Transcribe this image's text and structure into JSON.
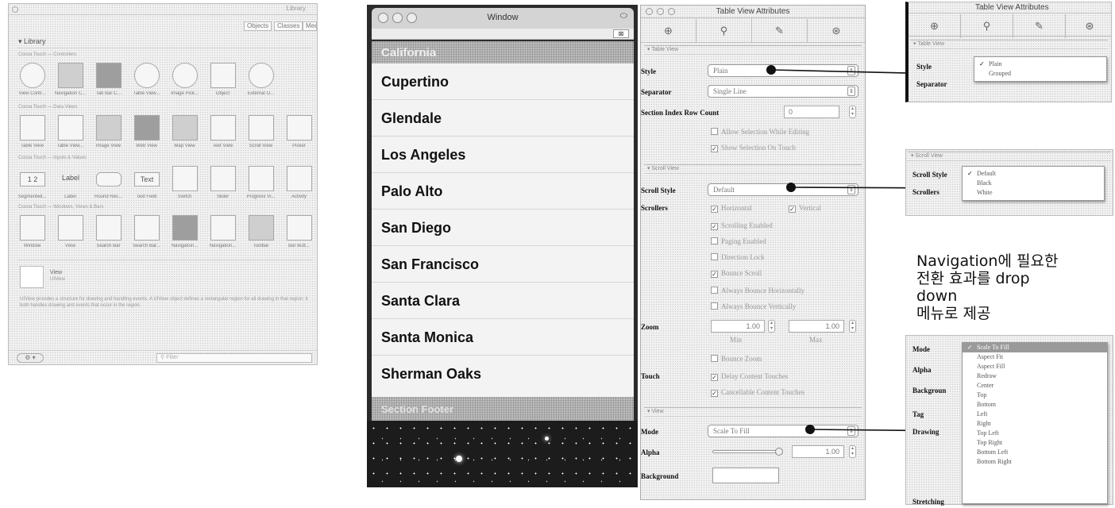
{
  "library": {
    "window_title": "Library",
    "segments": [
      "Objects",
      "Classes",
      "Media"
    ],
    "header_label": "Library",
    "sections": [
      "Cocoa Touch — Controllers",
      "Cocoa Touch — Data Views",
      "Cocoa Touch — Inputs & Values",
      "Cocoa Touch — Windows, Views & Bars"
    ],
    "tiles": [
      [
        "View Contr...",
        "Navigation C...",
        "Tab Bar C...",
        "Table View...",
        "Image Pick...",
        "Object",
        "External O..."
      ],
      [
        "Table View",
        "Table View...",
        "Image View",
        "Web View",
        "Map View",
        "Text View",
        "Scroll View",
        "Picker"
      ],
      [
        "Segmented...",
        "Label",
        "Round Rec...",
        "Text Field",
        "Switch",
        "Slider",
        "Progress Vi...",
        "Activity"
      ],
      [
        "Window",
        "View",
        "Search Bar",
        "Search Bar...",
        "Navigation...",
        "Navigation...",
        "Toolbar",
        "Bar Butt..."
      ]
    ],
    "tile_icons": [
      [
        "view-controller-icon",
        "navigation-controller-icon",
        "tab-bar-controller-icon",
        "table-view-controller-icon",
        "image-picker-icon",
        "object-icon",
        "external-object-icon"
      ],
      [
        "table-view-icon",
        "table-view-cell-icon",
        "image-view-icon",
        "web-view-icon",
        "map-view-icon",
        "text-view-icon",
        "scroll-view-icon",
        "picker-icon"
      ],
      [
        "segmented-control-icon",
        "label-icon",
        "round-rect-button-icon",
        "text-field-icon",
        "switch-icon",
        "slider-icon",
        "progress-view-icon",
        "activity-indicator-icon"
      ],
      [
        "window-icon",
        "view-icon",
        "search-bar-icon",
        "search-bar-controller-icon",
        "navigation-bar-icon",
        "navigation-item-icon",
        "toolbar-icon",
        "bar-button-item-icon"
      ]
    ],
    "label_tile_text": "Label",
    "text_tile_text": "Text",
    "segmented_tile_text": "1 2",
    "detail_name": "View",
    "detail_sub": "UIView",
    "detail_desc": "UIView provides a structure for drawing and handling events. A UIView object defines a rectangular region for all drawing in that region; it both handles drawing and events that occur in the region.",
    "gear_label": "⚙ ▾",
    "filter_placeholder": "Filter"
  },
  "simulator": {
    "window_title": "Window",
    "header": "California",
    "rows": [
      "Cupertino",
      "Glendale",
      "Los Angeles",
      "Palo Alto",
      "San Diego",
      "San Francisco",
      "Santa Clara",
      "Santa Monica",
      "Sherman Oaks"
    ],
    "footer": "Section Footer",
    "mini_btn": "⊠"
  },
  "inspector": {
    "title": "Table View Attributes",
    "tabs": [
      "⊕",
      "⚲",
      "✎",
      "⊛"
    ],
    "table_view": {
      "header": "▾ Table View",
      "style_label": "Style",
      "style_value": "Plain",
      "separator_label": "Separator",
      "separator_value": "Single Line",
      "section_index_label": "Section Index Row Count",
      "section_index_value": "0",
      "allow_selection_editing": "Allow Selection While Editing",
      "show_selection_touch": "Show Selection On Touch"
    },
    "scroll_view": {
      "header": "▾ Scroll View",
      "style_label": "Scroll Style",
      "style_value": "Default",
      "scrollers_label": "Scrollers",
      "horizontal": "Horizontal",
      "vertical": "Vertical",
      "scrolling_enabled": "Scrolling Enabled",
      "paging_enabled": "Paging Enabled",
      "direction_lock": "Direction Lock",
      "bounce_scroll": "Bounce Scroll",
      "always_bounce_h": "Always Bounce Horizontally",
      "always_bounce_v": "Always Bounce Vertically",
      "zoom_label": "Zoom",
      "zoom_min": "1.00",
      "zoom_max": "1.00",
      "min_label": "Min",
      "max_label": "Max",
      "bounce_zoom": "Bounce Zoom",
      "touch_label": "Touch",
      "delay_touches": "Delay Content Touches",
      "cancellable_touches": "Cancellable Content Touches"
    },
    "view": {
      "header": "▾ View",
      "mode_label": "Mode",
      "mode_value": "Scale To Fill",
      "alpha_label": "Alpha",
      "alpha_value": "1.00",
      "alpha_level": 1.0,
      "background_label": "Background"
    }
  },
  "crop_style": {
    "title": "Table View Attributes",
    "header": "▾ Table View",
    "style_label": "Style",
    "separator_label": "Separator",
    "options": [
      "Plain",
      "Grouped"
    ],
    "selected": "Plain"
  },
  "crop_scroll": {
    "header": "▾ Scroll View",
    "style_label": "Scroll Style",
    "scrollers_label": "Scrollers",
    "options": [
      "Default",
      "Black",
      "White"
    ],
    "selected": "Default"
  },
  "note": {
    "line1": "Navigation에 필요한",
    "line2": "전환 효과를 drop",
    "line3": "down",
    "line4": "메뉴로 제공"
  },
  "crop_mode": {
    "labels": [
      "Mode",
      "Alpha",
      "Backgroun",
      "Tag",
      "Drawing",
      "Stretching"
    ],
    "options": [
      "Scale To Fill",
      "Aspect Fit",
      "Aspect Fill",
      "Redraw",
      "Center",
      "Top",
      "Bottom",
      "Left",
      "Right",
      "Top Left",
      "Top Right",
      "Bottom Left",
      "Bottom Right"
    ],
    "selected": "Scale To Fill"
  }
}
